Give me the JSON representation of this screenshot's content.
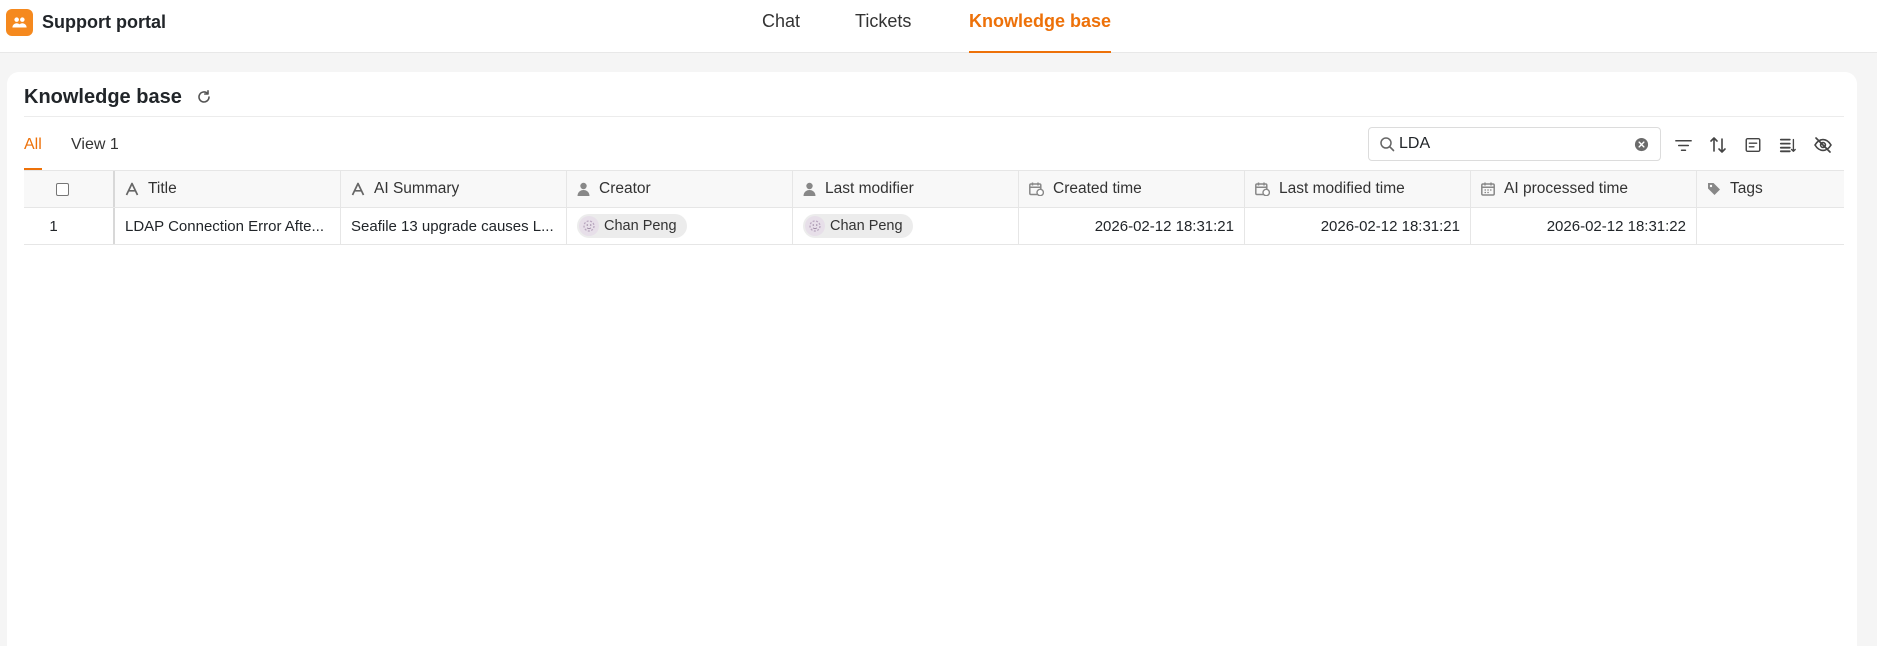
{
  "app": {
    "name": "Support portal",
    "logo_icon": "users-icon",
    "accent_color": "#ed7109"
  },
  "nav": {
    "items": [
      {
        "label": "Chat",
        "active": false
      },
      {
        "label": "Tickets",
        "active": false
      },
      {
        "label": "Knowledge base",
        "active": true
      }
    ]
  },
  "page": {
    "title": "Knowledge base",
    "refresh_icon": "refresh-icon"
  },
  "views": {
    "items": [
      {
        "label": "All",
        "active": true
      },
      {
        "label": "View 1",
        "active": false
      }
    ]
  },
  "search": {
    "value": "LDA",
    "placeholder": ""
  },
  "toolbar": {
    "icons": [
      "filter-icon",
      "sort-icon",
      "group-icon",
      "row-height-icon",
      "hide-columns-icon"
    ]
  },
  "table": {
    "columns": [
      {
        "label": "Title",
        "icon": "text-icon"
      },
      {
        "label": "AI Summary",
        "icon": "text-icon"
      },
      {
        "label": "Creator",
        "icon": "person-icon"
      },
      {
        "label": "Last modifier",
        "icon": "person-icon"
      },
      {
        "label": "Created time",
        "icon": "calendar-clock-icon"
      },
      {
        "label": "Last modified time",
        "icon": "calendar-clock-icon"
      },
      {
        "label": "AI processed time",
        "icon": "calendar-icon"
      },
      {
        "label": "Tags",
        "icon": "tag-icon"
      }
    ],
    "rows": [
      {
        "index": "1",
        "title": "LDAP Connection Error Afte...",
        "ai_summary": "Seafile 13 upgrade causes L...",
        "creator": "Chan Peng",
        "last_modifier": "Chan Peng",
        "created_time": "2026-02-12 18:31:21",
        "last_modified_time": "2026-02-12 18:31:21",
        "ai_processed_time": "2026-02-12 18:31:22",
        "tags": ""
      }
    ]
  }
}
